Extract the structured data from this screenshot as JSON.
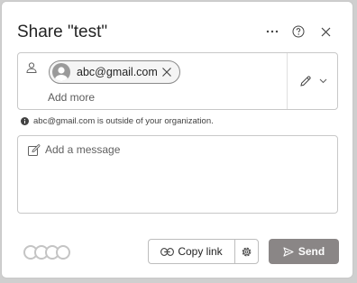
{
  "dialog": {
    "title": "Share \"test\""
  },
  "header": {
    "more_icon": "more-horizontal-icon",
    "help_icon": "help-circle-icon",
    "close_icon": "close-icon"
  },
  "recipients": {
    "chips": [
      {
        "label": "abc@gmail.com"
      }
    ],
    "add_more": "Add more",
    "permission_icon": "pencil-icon"
  },
  "warning": {
    "text": "abc@gmail.com is outside of your organization."
  },
  "message": {
    "placeholder": "Add a message"
  },
  "footer": {
    "copy_link_label": "Copy link",
    "send_label": "Send",
    "send_color": "#8a8686"
  }
}
